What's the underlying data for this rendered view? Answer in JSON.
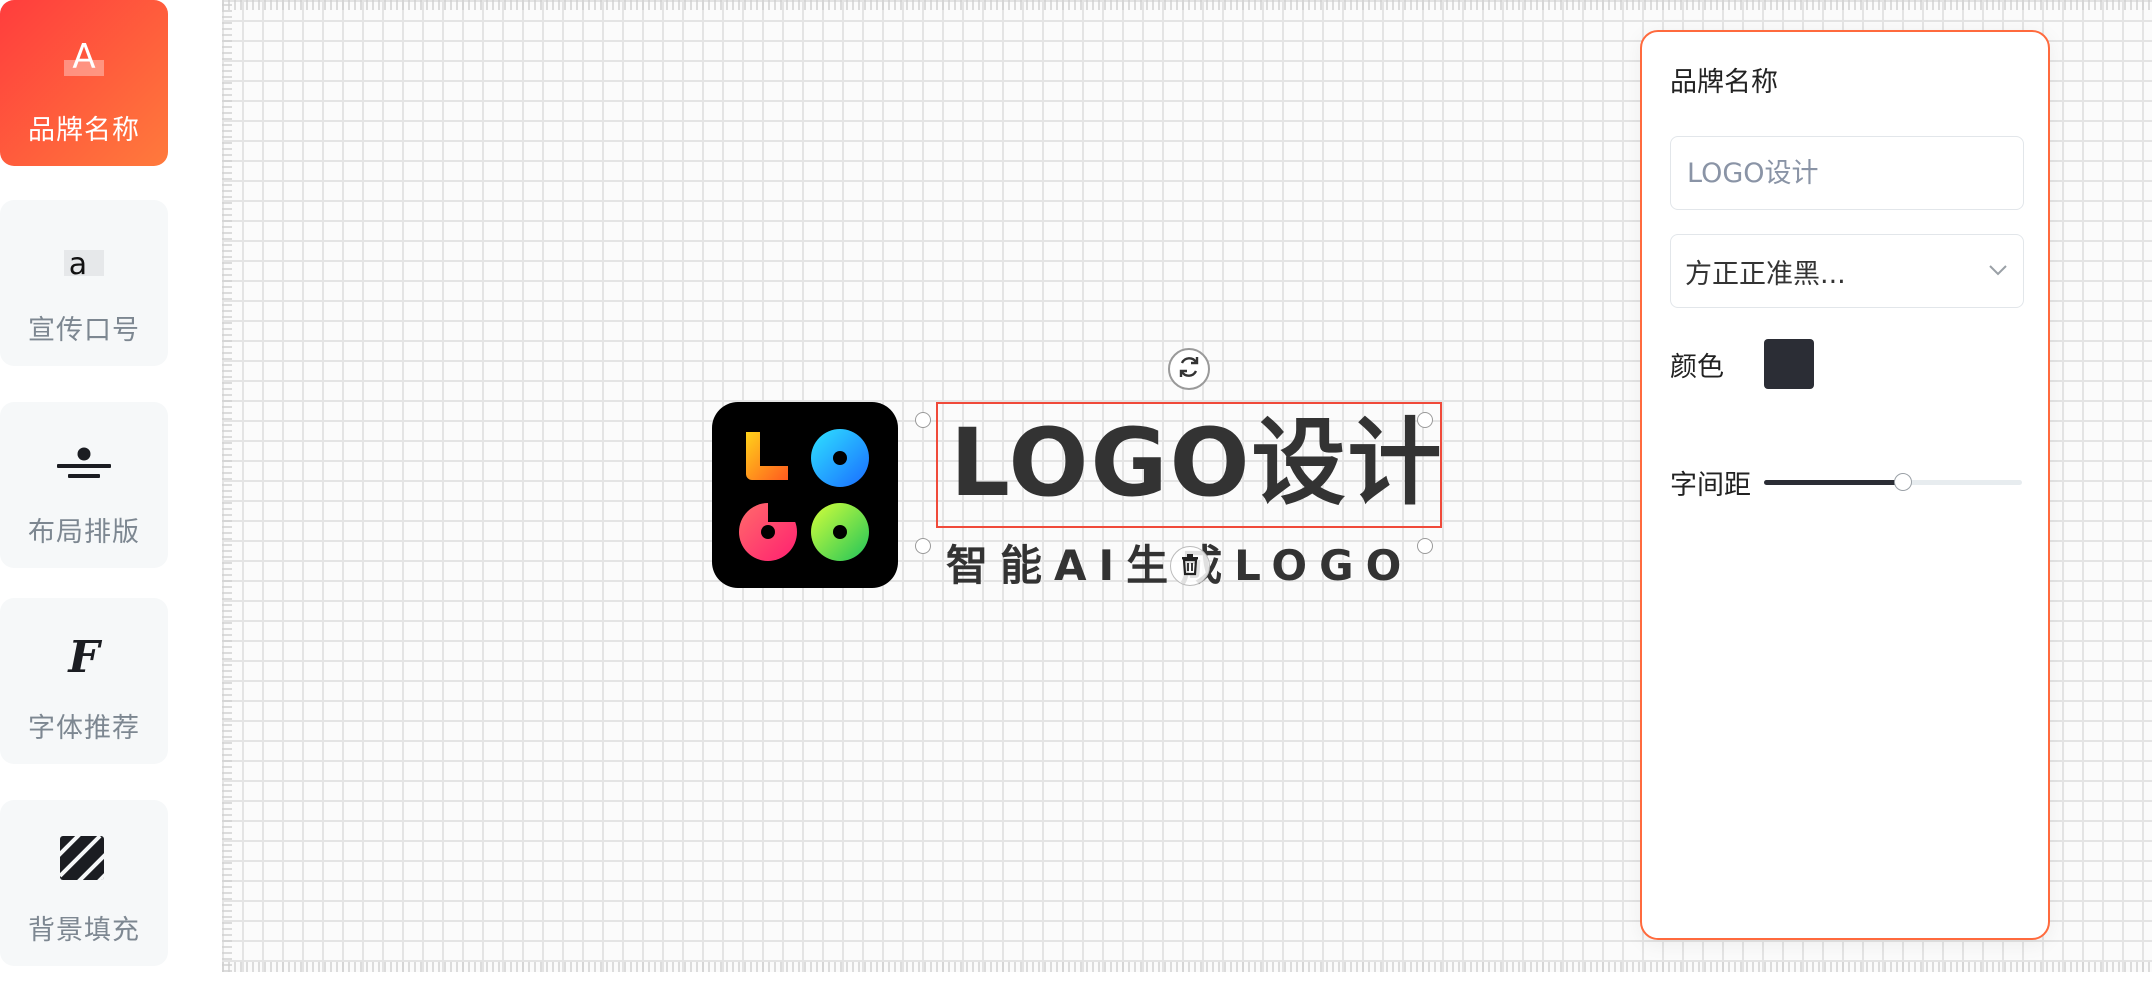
{
  "sidebar": {
    "items": [
      {
        "label": "品牌名称",
        "icon": "brand-name-icon",
        "active": true
      },
      {
        "label": "宣传口号",
        "icon": "slogan-icon",
        "active": false
      },
      {
        "label": "布局排版",
        "icon": "layout-icon",
        "active": false
      },
      {
        "label": "字体推荐",
        "icon": "font-recommend-icon",
        "active": false
      },
      {
        "label": "背景填充",
        "icon": "background-fill-icon",
        "active": false
      }
    ],
    "active_gradient": [
      "#ff3d3d",
      "#ff7a3c"
    ]
  },
  "canvas": {
    "brand_text": "LOGO设计",
    "slogan_text": "智能AI生成LOGO",
    "logo_mark_letters": [
      "L",
      "O",
      "G",
      "O"
    ]
  },
  "panel": {
    "title": "品牌名称",
    "name_input": {
      "value": "",
      "placeholder": "LOGO设计"
    },
    "font_select": {
      "value": "方正正准黑..."
    },
    "color_label": "颜色",
    "color_value": "#2b2d35",
    "spacing_label": "字间距",
    "spacing_level": 0.54
  },
  "colors": {
    "accent": "#ff6a3d",
    "selection": "#f04a3a",
    "text": "#333333"
  }
}
